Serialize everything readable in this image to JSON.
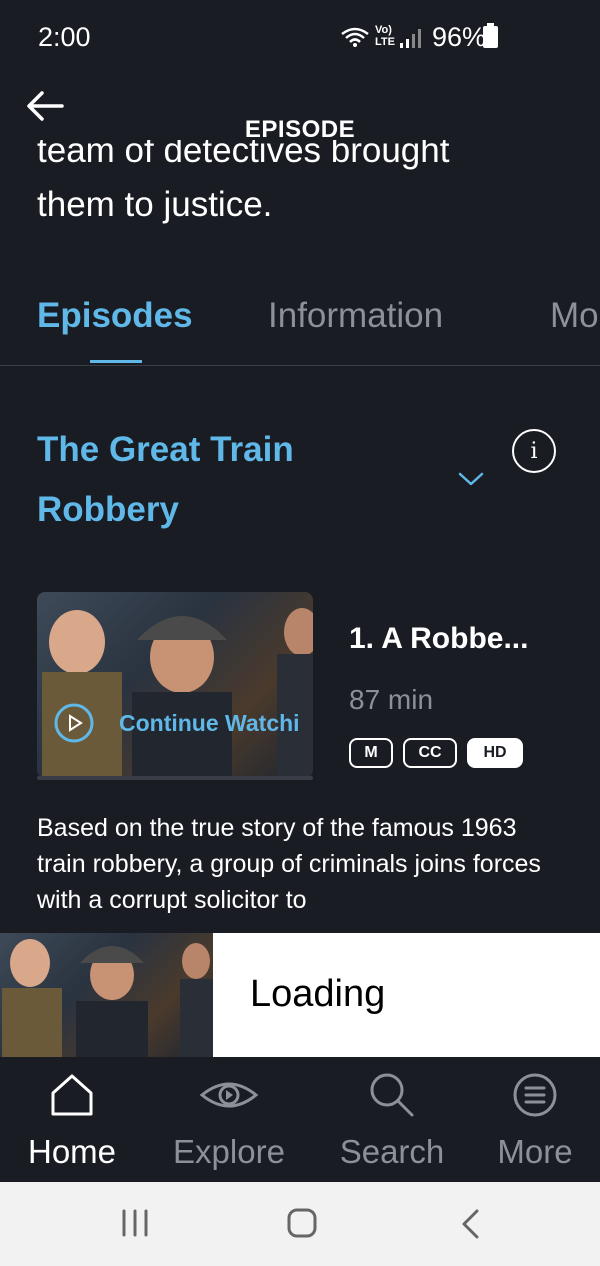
{
  "status_bar": {
    "time": "2:00",
    "network_label": "LTE",
    "volte_label": "Vo)",
    "battery": "96%"
  },
  "header": {
    "title": "EPISODE"
  },
  "synopsis_fragment": {
    "line1": "team of detectives brought",
    "line2": "them to justice."
  },
  "tabs": [
    {
      "label": "Episodes",
      "active": true
    },
    {
      "label": "Information",
      "active": false
    },
    {
      "label": "Mo",
      "active": false
    }
  ],
  "season": {
    "title": "The Great Train Robbery"
  },
  "episode": {
    "title": "1. A Robbe...",
    "duration": "87 min",
    "continue_label": "Continue Watchi",
    "badges": [
      "M",
      "CC",
      "HD"
    ],
    "description": "Based on the true story of the famous 1963 train robbery, a group of criminals joins forces with a corrupt solicitor to"
  },
  "mini_player": {
    "status": "Loading"
  },
  "bottom_nav": [
    {
      "label": "Home",
      "icon": "home-icon",
      "active": true
    },
    {
      "label": "Explore",
      "icon": "eye-icon",
      "active": false
    },
    {
      "label": "Search",
      "icon": "search-icon",
      "active": false
    },
    {
      "label": "More",
      "icon": "menu-circle-icon",
      "active": false
    }
  ],
  "colors": {
    "background": "#1a1c24",
    "accent": "#5fb8e8",
    "muted": "#8d9099"
  }
}
